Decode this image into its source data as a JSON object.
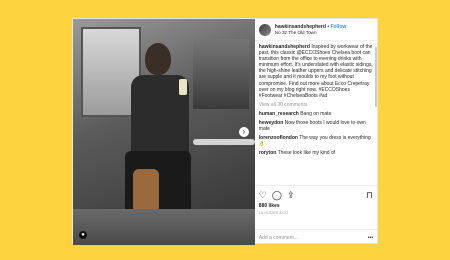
{
  "post": {
    "username": "hawkinsandshepherd",
    "follow": "Follow",
    "location": "No 32 The Old Town",
    "caption": {
      "user": "hawkinsandshepherd",
      "text": "Inspired by workwear of the past, this classic @ECCOShoes Chelsea boot can transition from the office to evening drinks with minimum effort. It's understated with elastic sidings, the high-shine leather uppers and delicate stitching are supple and it moulds to my foot without compromise. Find out more about Ecco Crepetray over on my blog right now. #ECCOShoes #Footwear #ChelseaBoots #ad"
    },
    "view_all": "View all 30 comments",
    "comments": [
      {
        "user": "human_research",
        "text": "Bang on mate"
      },
      {
        "user": "heweydon",
        "text": "Now those boots I would love to own mate"
      },
      {
        "user": "lorenzooflondon",
        "text": "The way you dress is everything 👌"
      },
      {
        "user": "roryton",
        "text": "These look like my kind of"
      }
    ],
    "likes": "880 likes",
    "time": "15 hours ago",
    "add_comment_placeholder": "Add a comment...",
    "more": "•••"
  },
  "icons": {
    "like": "heart-icon",
    "comment": "comment-icon",
    "share": "share-icon",
    "save": "bookmark-icon",
    "next": "chevron-right-icon",
    "tag": "person-tag-icon"
  },
  "colors": {
    "background": "#fdd43f",
    "follow": "#3897f0"
  }
}
